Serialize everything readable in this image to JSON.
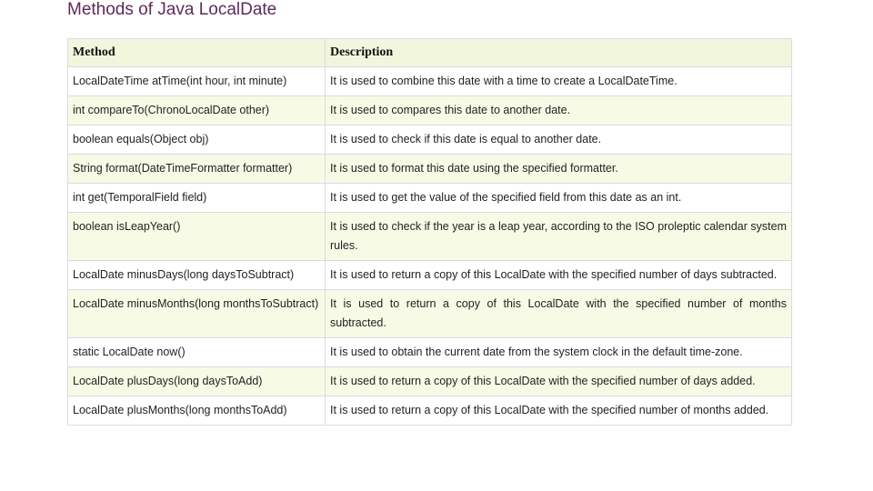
{
  "page": {
    "title": "Methods of Java LocalDate"
  },
  "table": {
    "headers": {
      "method": "Method",
      "description": "Description"
    },
    "rows": [
      {
        "method": "LocalDateTime atTime(int hour, int minute)",
        "description": "It is used to combine this date with a time to create a LocalDateTime."
      },
      {
        "method": "int compareTo(ChronoLocalDate other)",
        "description": "It is used to compares this date to another date."
      },
      {
        "method": "boolean equals(Object obj)",
        "description": "It is used to check if this date is equal to another date."
      },
      {
        "method": "String format(DateTimeFormatter formatter)",
        "description": "It is used to format this date using the specified formatter."
      },
      {
        "method": "int get(TemporalField field)",
        "description": "It is used to get the value of the specified field from this date as an int."
      },
      {
        "method": "boolean isLeapYear()",
        "description": "It is used to check if the year is a leap year, according to the ISO proleptic calendar system rules."
      },
      {
        "method": "LocalDate minusDays(long daysToSubtract)",
        "description": "It is used to return a copy of this LocalDate with the specified number of days subtracted."
      },
      {
        "method": "LocalDate minusMonths(long monthsToSubtract)",
        "description": "It is used to return a copy of this LocalDate with the specified number of months subtracted."
      },
      {
        "method": "static LocalDate now()",
        "description": "It is used to obtain the current date from the system clock in the default time-zone."
      },
      {
        "method": "LocalDate plusDays(long daysToAdd)",
        "description": "It is used to return a copy of this LocalDate with the specified number of days added."
      },
      {
        "method": "LocalDate plusMonths(long monthsToAdd)",
        "description": "It is used to return a copy of this LocalDate with the specified number of months added."
      }
    ]
  },
  "colors": {
    "title": "#5e2a5a",
    "header_bg": "#f2f6dc",
    "alt_row_bg": "#f7fbe6",
    "border": "#e2d7e0"
  }
}
